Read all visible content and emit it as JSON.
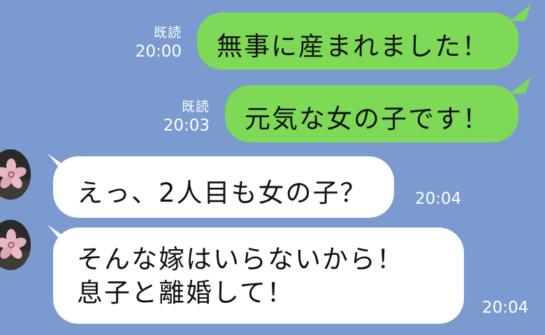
{
  "chat": {
    "messages": [
      {
        "sender": "me",
        "read": "既読",
        "time": "20:00",
        "text": "無事に産まれました！"
      },
      {
        "sender": "me",
        "read": "既読",
        "time": "20:03",
        "text": "元気な女の子です！"
      },
      {
        "sender": "other",
        "time": "20:04",
        "text": "えっ、2人目も女の子？"
      },
      {
        "sender": "other",
        "time": "20:04",
        "text": "そんな嫁はいらないから！\n息子と離婚して！"
      }
    ]
  },
  "colors": {
    "background": "#7a9ad0",
    "sent_bubble": "#7ed957",
    "received_bubble": "#ffffff",
    "meta_text": "#ffffff"
  },
  "icons": {
    "avatar": "cherry-blossom-avatar"
  }
}
